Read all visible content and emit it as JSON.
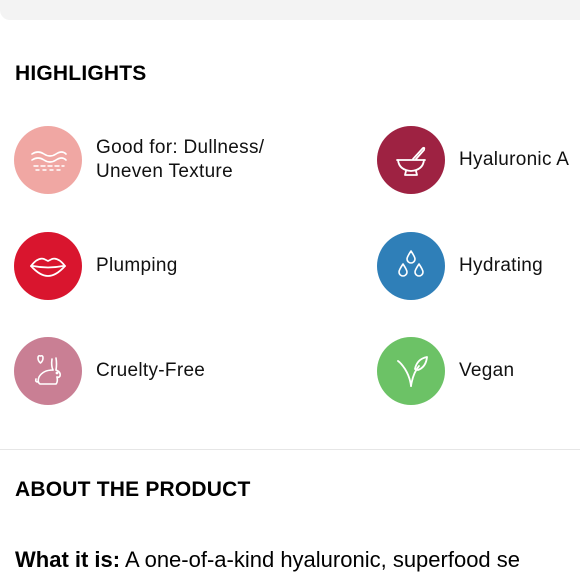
{
  "highlights": {
    "title": "HIGHLIGHTS",
    "items": [
      {
        "label": "Good for: Dullness/\nUneven Texture",
        "icon": "skin-texture-icon",
        "color": "#f0a7a3"
      },
      {
        "label": "Hyaluronic A",
        "icon": "mortar-pestle-icon",
        "color": "#9e2242"
      },
      {
        "label": "Plumping",
        "icon": "lips-icon",
        "color": "#d9152e"
      },
      {
        "label": "Hydrating",
        "icon": "water-drops-icon",
        "color": "#2f7fb8"
      },
      {
        "label": "Cruelty-Free",
        "icon": "bunny-heart-icon",
        "color": "#c97f94"
      },
      {
        "label": "Vegan",
        "icon": "leaf-sprout-icon",
        "color": "#6cc266"
      }
    ]
  },
  "about": {
    "title": "ABOUT THE PRODUCT",
    "what_it_is_label": "What it is:",
    "what_it_is_text": " A one-of-a-kind hyaluronic, superfood se"
  }
}
